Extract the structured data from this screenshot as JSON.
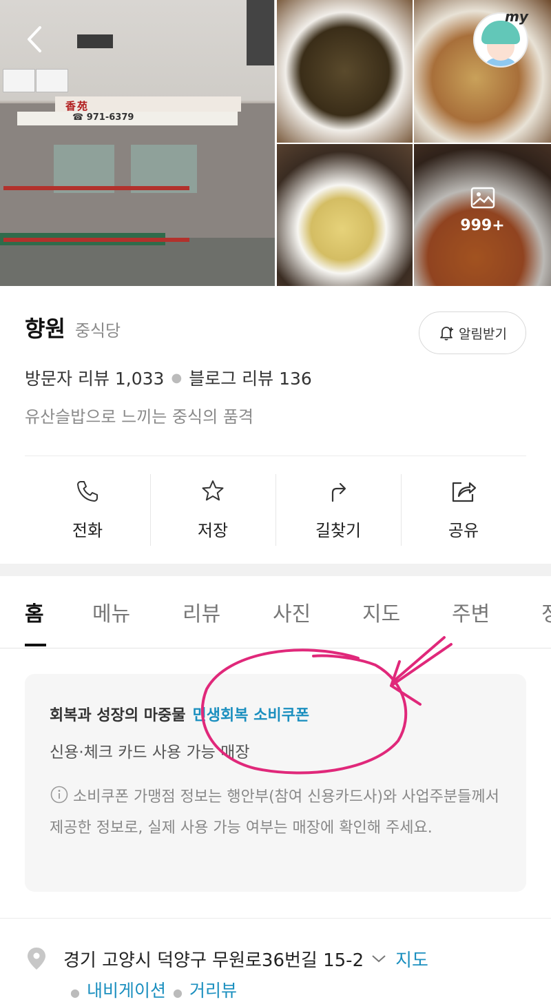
{
  "header": {
    "back_icon": "chevron-left-icon",
    "store_sign": "香苑",
    "store_phone_sign": "☎ 971-6379",
    "my_label": "my",
    "photo_more_count": "999+",
    "photo_more_icon": "image-icon"
  },
  "place": {
    "name": "향원",
    "category": "중식당",
    "notify_label": "알림받기",
    "visitor_review_label": "방문자 리뷰 1,033",
    "blog_review_label": "블로그 리뷰 136",
    "tagline": "유산슬밥으로 느끼는 중식의 품격"
  },
  "actions": [
    {
      "label": "전화",
      "icon": "phone-icon"
    },
    {
      "label": "저장",
      "icon": "star-icon"
    },
    {
      "label": "길찾기",
      "icon": "directions-icon"
    },
    {
      "label": "공유",
      "icon": "share-icon"
    }
  ],
  "tabs": [
    "홈",
    "메뉴",
    "리뷰",
    "사진",
    "지도",
    "주변",
    "정"
  ],
  "active_tab": "홈",
  "coupon": {
    "prefix": "회복과 성장의 마중물",
    "highlight": "민생회복 소비쿠폰",
    "subtitle": "신용·체크 카드 사용 가능 매장",
    "note": "소비쿠폰 가맹점 정보는 행안부(참여 신용카드사)와 사업주분들께서 제공한 정보로, 실제 사용 가능 여부는 매장에 확인해 주세요."
  },
  "address": {
    "text": "경기 고양시 덕양구 무원로36번길 15-2",
    "map_link": "지도",
    "navigation": "내비게이션",
    "street_view": "거리뷰"
  },
  "colors": {
    "link": "#1b8fbf",
    "annotation": "#e0287a",
    "rail": "#b2312c"
  }
}
